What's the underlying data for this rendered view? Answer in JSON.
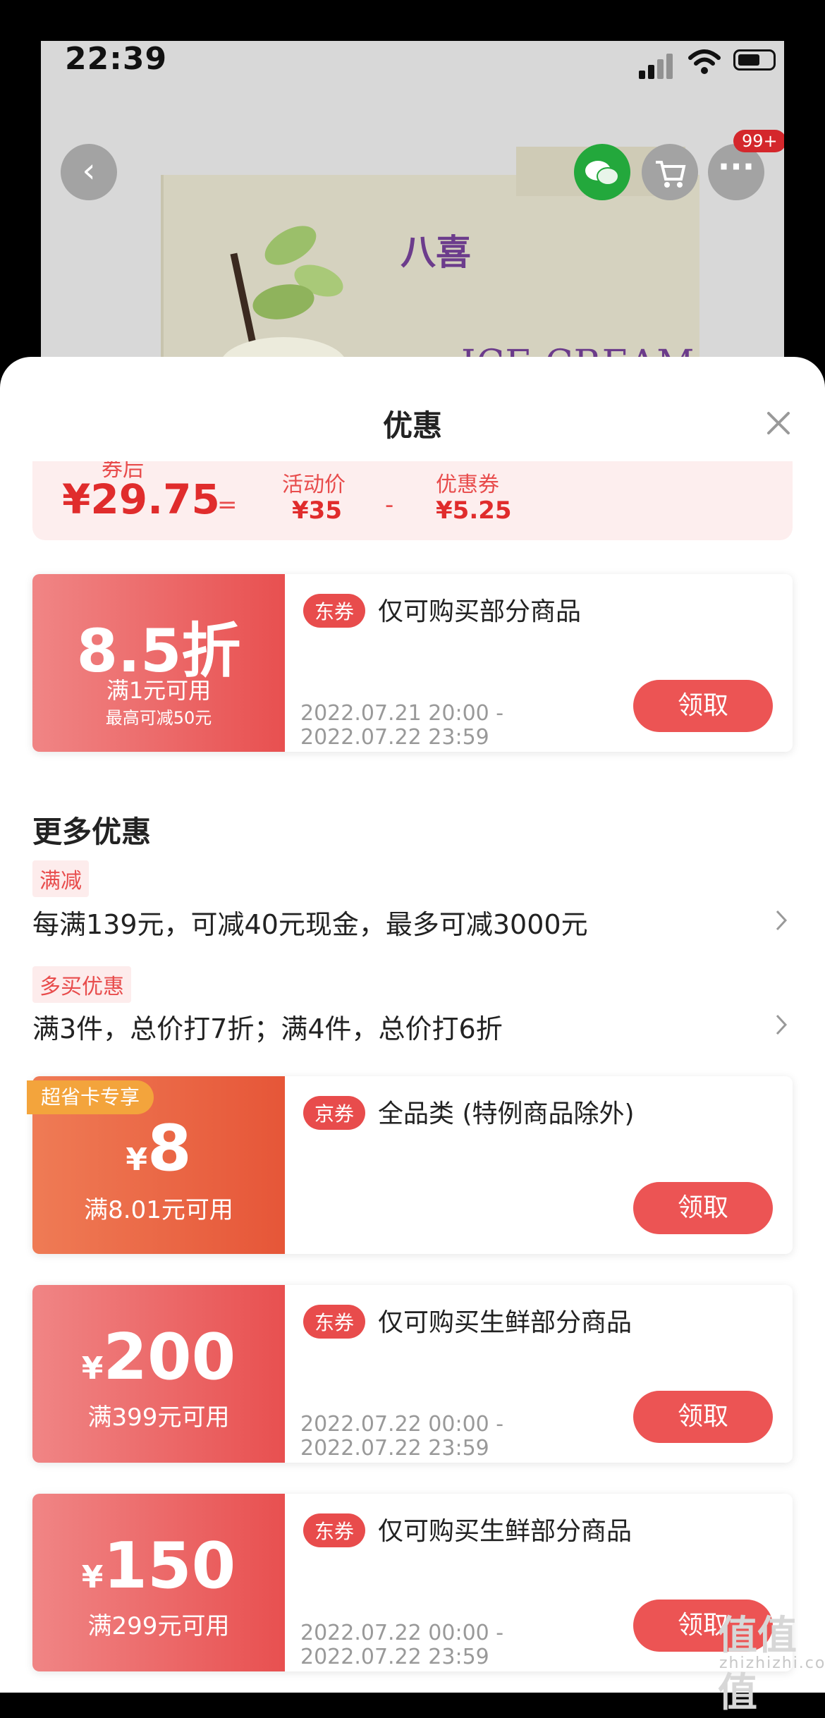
{
  "status_bar": {
    "time": "22:39"
  },
  "background": {
    "badge": "99+",
    "product_brand": "八喜",
    "product_title": "ICE CREAM"
  },
  "sheet": {
    "title": "优惠",
    "price_breakdown": {
      "final_label": "券后",
      "final_price": "¥29.75",
      "equals": "=",
      "activity_label": "活动价",
      "activity_price": "¥35",
      "minus": "-",
      "coupon_label": "优惠券",
      "coupon_price": "¥5.25"
    },
    "top_coupon": {
      "amount": "8.5折",
      "condition": "满1元可用",
      "max_note": "最高可减50元",
      "tag": "东券",
      "desc": "仅可购买部分商品",
      "date_start": "2022.07.21 20:00 -",
      "date_end": "2022.07.22 23:59",
      "button": "领取"
    },
    "more_title": "更多优惠",
    "promos": [
      {
        "tag": "满减",
        "text": "每满139元，可减40元现金，最多可减3000元"
      },
      {
        "tag": "多买优惠",
        "text": "满3件，总价打7折；满4件，总价打6折"
      }
    ],
    "coupons": [
      {
        "super_tag": "超省卡专享",
        "currency": "¥",
        "amount": "8",
        "condition": "满8.01元可用",
        "tag": "京券",
        "desc": "全品类 (特例商品除外)",
        "button": "领取"
      },
      {
        "currency": "¥",
        "amount": "200",
        "condition": "满399元可用",
        "tag": "东券",
        "desc": "仅可购买生鲜部分商品",
        "date_start": "2022.07.22 00:00 -",
        "date_end": "2022.07.22 23:59",
        "button": "领取"
      },
      {
        "currency": "¥",
        "amount": "150",
        "condition": "满299元可用",
        "tag": "东券",
        "desc": "仅可购买生鲜部分商品",
        "date_start": "2022.07.22 00:00 -",
        "date_end": "2022.07.22 23:59",
        "button": "领取"
      }
    ]
  },
  "watermark": {
    "logo": "值值值",
    "site": "zhizhizhi.com"
  },
  "colors": {
    "accent": "#e84c4c",
    "coupon_gradient_start": "#f08585",
    "orange": "#ef7b55",
    "super_tag": "#f3a43c"
  }
}
